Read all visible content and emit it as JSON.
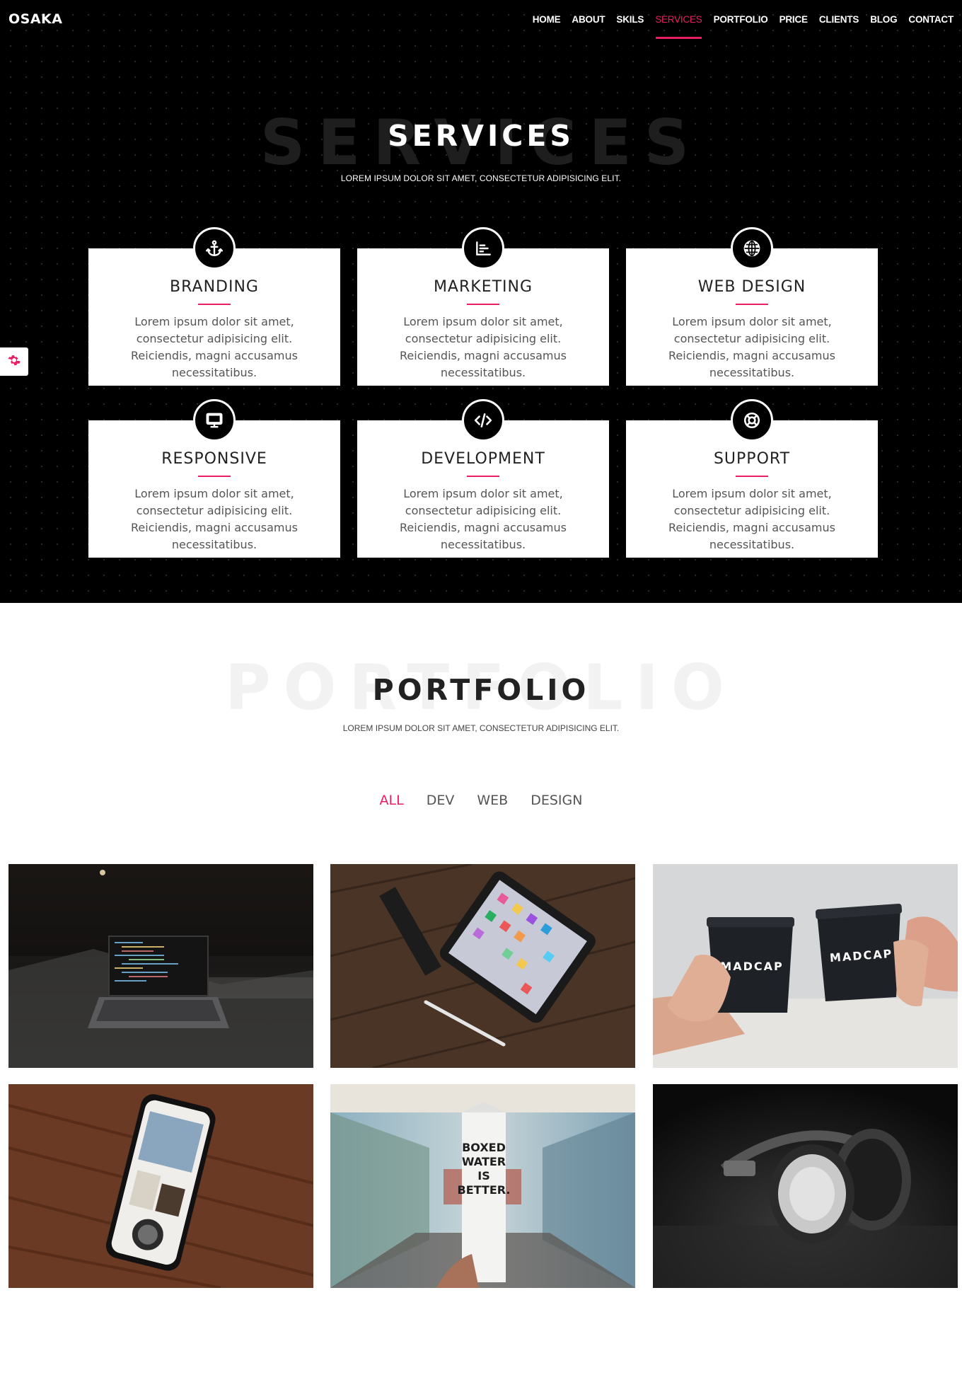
{
  "brand": {
    "logo": "OSAKA",
    "accent_color": "#e91e63"
  },
  "nav": {
    "items": [
      {
        "label": "HOME",
        "active": false
      },
      {
        "label": "ABOUT",
        "active": false
      },
      {
        "label": "SKILS",
        "active": false
      },
      {
        "label": "SERVICES",
        "active": true
      },
      {
        "label": "PORTFOLIO",
        "active": false
      },
      {
        "label": "PRICE",
        "active": false
      },
      {
        "label": "CLIENTS",
        "active": false
      },
      {
        "label": "BLOG",
        "active": false
      },
      {
        "label": "CONTACT",
        "active": false
      }
    ]
  },
  "services": {
    "ghost": "SERVICES",
    "title": "SERVICES",
    "subtitle": "LOREM IPSUM DOLOR SIT AMET, CONSECTETUR ADIPISICING ELIT.",
    "items": [
      {
        "title": "BRANDING",
        "icon": "anchor-icon",
        "text": "Lorem ipsum dolor sit amet, consectetur adipisicing elit. Reiciendis, magni accusamus necessitatibus."
      },
      {
        "title": "MARKETING",
        "icon": "chart-icon",
        "text": "Lorem ipsum dolor sit amet, consectetur adipisicing elit. Reiciendis, magni accusamus necessitatibus."
      },
      {
        "title": "WEB DESIGN",
        "icon": "globe-icon",
        "text": "Lorem ipsum dolor sit amet, consectetur adipisicing elit. Reiciendis, magni accusamus necessitatibus."
      },
      {
        "title": "RESPONSIVE",
        "icon": "desktop-icon",
        "text": "Lorem ipsum dolor sit amet, consectetur adipisicing elit. Reiciendis, magni accusamus necessitatibus."
      },
      {
        "title": "DEVELOPMENT",
        "icon": "code-icon",
        "text": "Lorem ipsum dolor sit amet, consectetur adipisicing elit. Reiciendis, magni accusamus necessitatibus."
      },
      {
        "title": "SUPPORT",
        "icon": "life-ring-icon",
        "text": "Lorem ipsum dolor sit amet, consectetur adipisicing elit. Reiciendis, magni accusamus necessitatibus."
      }
    ]
  },
  "settings": {
    "icon": "gear-icon"
  },
  "portfolio": {
    "ghost": "PORTFOLIO",
    "title": "PORTFOLIO",
    "subtitle": "LOREM IPSUM DOLOR SIT AMET, CONSECTETUR ADIPISICING ELIT.",
    "filters": [
      {
        "label": "ALL",
        "active": true
      },
      {
        "label": "DEV",
        "active": false
      },
      {
        "label": "WEB",
        "active": false
      },
      {
        "label": "DESIGN",
        "active": false
      }
    ],
    "images": [
      {
        "name": "laptop-code-image"
      },
      {
        "name": "tablet-apps-image"
      },
      {
        "name": "coffee-cups-image",
        "text_logo": "MADCAP"
      },
      {
        "name": "phone-on-wood-image"
      },
      {
        "name": "boxed-water-image",
        "text_logo": "BOXED WATER IS BETTER."
      },
      {
        "name": "headphones-image"
      }
    ]
  }
}
